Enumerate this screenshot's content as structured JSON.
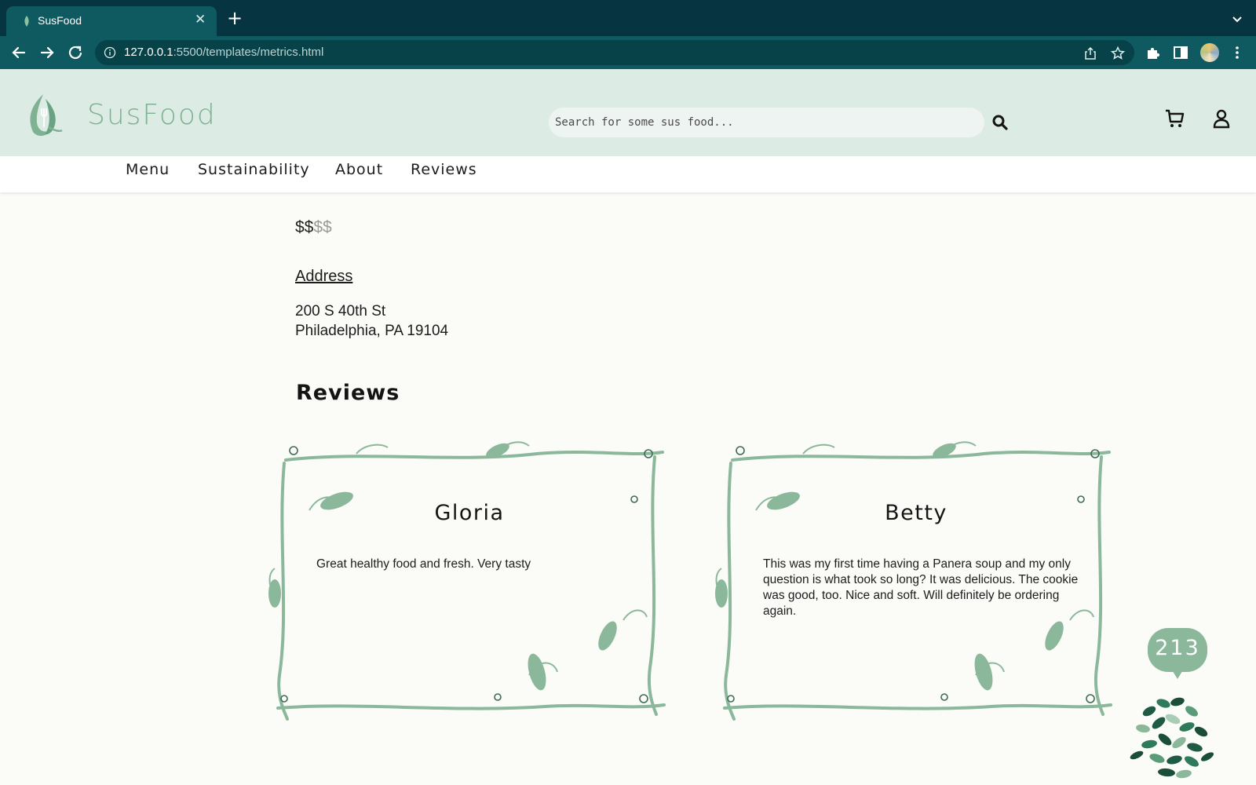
{
  "browser": {
    "tab_title": "SusFood",
    "url_host": "127.0.0.1",
    "url_path": ":5500/templates/metrics.html"
  },
  "site": {
    "brand": "SusFood",
    "search_placeholder": "Search for some sus food...",
    "nav": [
      "Menu",
      "Sustainability",
      "About",
      "Reviews"
    ]
  },
  "restaurant": {
    "price_active": "$$",
    "price_inactive": "$$",
    "price_level": 2,
    "price_max": 4,
    "address_heading": "Address",
    "address_line1": "200 S 40th St",
    "address_line2": "Philadelphia, PA 19104"
  },
  "reviews": {
    "heading": "Reviews",
    "items": [
      {
        "name": "Gloria",
        "text": "Great healthy food and fresh. Very tasty"
      },
      {
        "name": "Betty",
        "text": "This was my first time having a Panera soup and my only question is what took so long? It was delicious. The cookie was good, too. Nice and soft. Will definitely be ordering again."
      }
    ]
  },
  "counter": {
    "value": "213"
  },
  "colors": {
    "tabbar": "#063440",
    "toolbar": "#0f5a61",
    "header_bg": "#dcebe4",
    "brand_green": "#7fb293",
    "vine_green": "#8bb89b",
    "page_bg": "#fbfcf8"
  },
  "icons": [
    "leaf-favicon-icon",
    "close-icon",
    "plus-icon",
    "chevron-down-icon",
    "back-arrow-icon",
    "forward-arrow-icon",
    "reload-icon",
    "info-icon",
    "share-icon",
    "star-icon",
    "puzzle-icon",
    "side-panel-icon",
    "search-icon",
    "cart-icon",
    "user-icon",
    "leaf-fork-logo-icon"
  ]
}
